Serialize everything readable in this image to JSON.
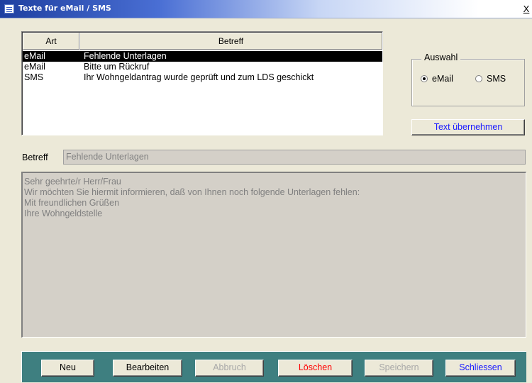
{
  "window": {
    "title": "Texte für eMail / SMS",
    "close_glyph": "X"
  },
  "list": {
    "columns": [
      "Art",
      "Betreff"
    ],
    "rows": [
      {
        "art": "eMail",
        "betreff": "Fehlende Unterlagen",
        "selected": true
      },
      {
        "art": "eMail",
        "betreff": "Bitte um Rückruf",
        "selected": false
      },
      {
        "art": "SMS",
        "betreff": "Ihr Wohngeldantrag wurde geprüft und zum LDS geschickt",
        "selected": false
      }
    ]
  },
  "auswahl": {
    "label": "Auswahl",
    "options": [
      {
        "label": "eMail",
        "checked": true
      },
      {
        "label": "SMS",
        "checked": false
      }
    ]
  },
  "buttons": {
    "uebernehmen": "Text übernehmen",
    "neu": "Neu",
    "bearbeiten": "Bearbeiten",
    "abbruch": "Abbruch",
    "loeschen": "Löschen",
    "speichern": "Speichern",
    "schliessen": "Schliessen"
  },
  "form": {
    "betreff_label": "Betreff",
    "betreff_value": "Fehlende Unterlagen",
    "body_lines": [
      "Sehr geehrte/r Herr/Frau",
      "",
      "Wir möchten Sie hiermit informieren, daß von Ihnen noch folgende Unterlagen fehlen:",
      "",
      "",
      "",
      "",
      "Mit freundlichen Grüßen",
      "Ihre Wohngeldstelle"
    ]
  },
  "colors": {
    "footer": "#3e7f80",
    "selected_row": "#000000",
    "link_blue": "#1a1aff",
    "delete_red": "#ff0000"
  }
}
